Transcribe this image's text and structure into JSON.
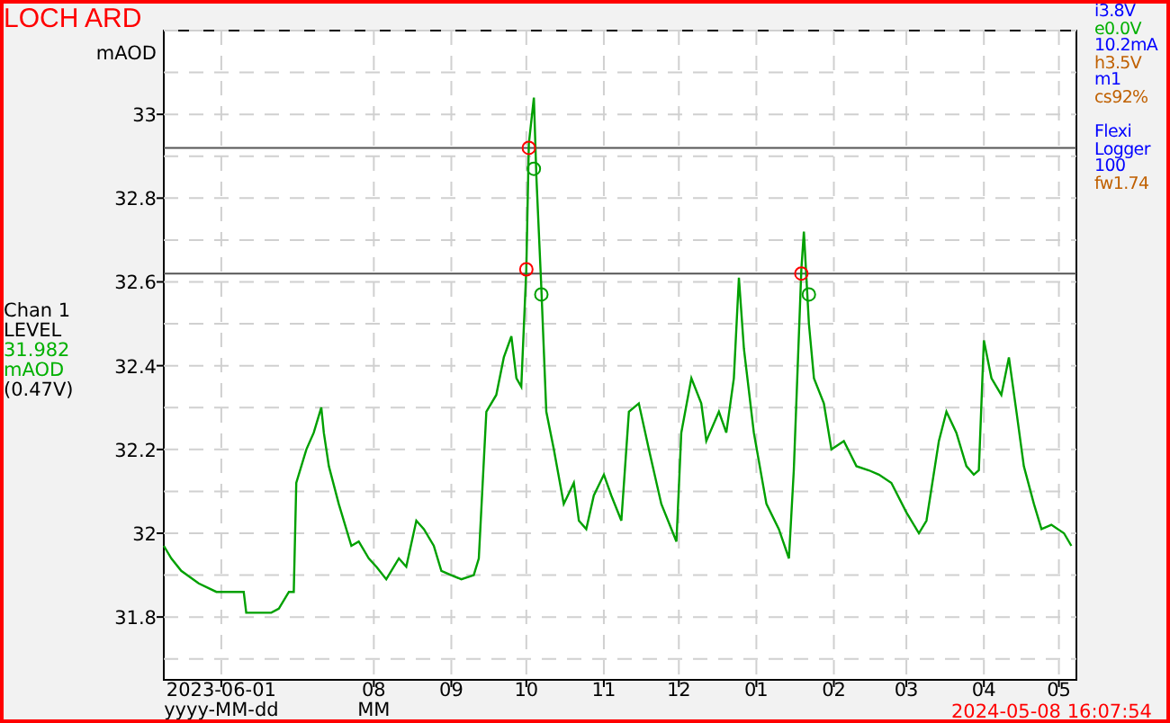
{
  "title": "LOCH ARD",
  "channel": {
    "type": "LEVEL",
    "reading": "31.982",
    "unit": "mAOD",
    "voltage": "(0.47V)"
  },
  "status": [
    {
      "text": "i3.8V",
      "color": "#0000ff"
    },
    {
      "text": "e0.0V",
      "color": "#00b000"
    },
    {
      "text": "10.2mA",
      "color": "#0000ff"
    },
    {
      "text": "h3.5V",
      "color": "#c06000"
    },
    {
      "text": "m1",
      "color": "#0000ff"
    },
    {
      "text": "cs92%",
      "color": "#c06000"
    }
  ],
  "logger": [
    {
      "text": "Flexi",
      "color": "#0000ff"
    },
    {
      "text": "Logger",
      "color": "#0000ff"
    },
    {
      "text": "100",
      "color": "#0000ff"
    },
    {
      "text": "fw1.74",
      "color": "#c06000"
    }
  ],
  "chart": {
    "format_labels": [
      "yyyy-MM-dd",
      "MM"
    ],
    "chart_data": {
      "type": "line",
      "ylabel": "mAOD",
      "x": [
        "2023-05-09",
        "2023-05-12",
        "2023-05-16",
        "2023-05-23",
        "2023-05-30",
        "2023-06-10",
        "2023-06-11",
        "2023-06-21",
        "2023-06-24",
        "2023-06-28",
        "2023-06-30",
        "2023-07-01",
        "2023-07-05",
        "2023-07-08",
        "2023-07-11",
        "2023-07-12",
        "2023-07-14",
        "2023-07-18",
        "2023-07-23",
        "2023-07-26",
        "2023-07-30",
        "2023-08-02",
        "2023-08-06",
        "2023-08-11",
        "2023-08-14",
        "2023-08-18",
        "2023-08-21",
        "2023-08-25",
        "2023-08-28",
        "2023-09-01",
        "2023-09-05",
        "2023-09-10",
        "2023-09-12",
        "2023-09-15",
        "2023-09-19",
        "2023-09-22",
        "2023-09-25",
        "2023-09-27",
        "2023-09-29",
        "2023-10-01",
        "2023-10-02",
        "2023-10-04",
        "2023-10-05",
        "2023-10-07",
        "2023-10-09",
        "2023-10-12",
        "2023-10-16",
        "2023-10-20",
        "2023-10-22",
        "2023-10-25",
        "2023-10-28",
        "2023-11-01",
        "2023-11-04",
        "2023-11-08",
        "2023-11-11",
        "2023-11-15",
        "2023-11-19",
        "2023-11-24",
        "2023-11-30",
        "2023-12-02",
        "2023-12-06",
        "2023-12-10",
        "2023-12-12",
        "2023-12-17",
        "2023-12-20",
        "2023-12-23",
        "2023-12-25",
        "2023-12-27",
        "2023-12-31",
        "2024-01-05",
        "2024-01-10",
        "2024-01-14",
        "2024-01-16",
        "2024-01-19",
        "2024-01-20",
        "2024-01-22",
        "2024-01-24",
        "2024-01-28",
        "2024-01-31",
        "2024-02-05",
        "2024-02-10",
        "2024-02-15",
        "2024-02-19",
        "2024-02-24",
        "2024-03-01",
        "2024-03-06",
        "2024-03-09",
        "2024-03-14",
        "2024-03-17",
        "2024-03-21",
        "2024-03-25",
        "2024-03-28",
        "2024-03-30",
        "2024-04-01",
        "2024-04-04",
        "2024-04-08",
        "2024-04-11",
        "2024-04-14",
        "2024-04-17",
        "2024-04-21",
        "2024-04-24",
        "2024-04-28",
        "2024-05-03",
        "2024-05-06"
      ],
      "series": [
        {
          "name": "Chan 1",
          "color": "#00a000",
          "values": [
            31.97,
            31.94,
            31.91,
            31.88,
            31.86,
            31.86,
            31.81,
            31.81,
            31.82,
            31.86,
            31.86,
            32.12,
            32.2,
            32.24,
            32.3,
            32.24,
            32.16,
            32.07,
            31.97,
            31.98,
            31.94,
            31.92,
            31.89,
            31.94,
            31.92,
            32.03,
            32.01,
            31.97,
            31.91,
            31.9,
            31.89,
            31.9,
            31.94,
            32.29,
            32.33,
            32.42,
            32.47,
            32.37,
            32.35,
            32.63,
            32.93,
            33.04,
            32.85,
            32.59,
            32.29,
            32.2,
            32.07,
            32.12,
            32.03,
            32.01,
            32.09,
            32.14,
            32.09,
            32.03,
            32.29,
            32.31,
            32.2,
            32.07,
            31.98,
            32.24,
            32.37,
            32.31,
            32.22,
            32.29,
            32.24,
            32.37,
            32.61,
            32.44,
            32.24,
            32.07,
            32.01,
            31.94,
            32.15,
            32.63,
            32.72,
            32.5,
            32.37,
            32.31,
            32.2,
            32.22,
            32.16,
            32.15,
            32.14,
            32.12,
            32.05,
            32.0,
            32.03,
            32.22,
            32.29,
            32.24,
            32.16,
            32.14,
            32.15,
            32.46,
            32.37,
            32.33,
            32.42,
            32.29,
            32.16,
            32.07,
            32.01,
            32.02,
            32.0,
            31.97
          ]
        },
        {
          "type": "scatter",
          "color": "#ff0000",
          "values": [
            null,
            null,
            null,
            null,
            null,
            null,
            null,
            null,
            null,
            null,
            null,
            null,
            null,
            null,
            null,
            null,
            null,
            null,
            null,
            null,
            null,
            null,
            null,
            null,
            null,
            null,
            null,
            null,
            null,
            null,
            null,
            null,
            null,
            null,
            null,
            null,
            null,
            null,
            null,
            32.63,
            32.92,
            null,
            null,
            null,
            null,
            null,
            null,
            null,
            null,
            null,
            null,
            null,
            null,
            null,
            null,
            null,
            null,
            null,
            null,
            null,
            null,
            null,
            null,
            null,
            null,
            null,
            null,
            null,
            null,
            null,
            null,
            null,
            null,
            32.62,
            null,
            null,
            null,
            null,
            null,
            null,
            null,
            null,
            null,
            null,
            null,
            null,
            null,
            null,
            null,
            null,
            null,
            null,
            null,
            null,
            null,
            null,
            null,
            null,
            null,
            null,
            null,
            null,
            null,
            null
          ]
        },
        {
          "type": "scatter",
          "color": "#00a000",
          "values": [
            null,
            null,
            null,
            null,
            null,
            null,
            null,
            null,
            null,
            null,
            null,
            null,
            null,
            null,
            null,
            null,
            null,
            null,
            null,
            null,
            null,
            null,
            null,
            null,
            null,
            null,
            null,
            null,
            null,
            null,
            null,
            null,
            null,
            null,
            null,
            null,
            null,
            null,
            null,
            null,
            null,
            32.87,
            null,
            32.57,
            null,
            null,
            null,
            null,
            null,
            null,
            null,
            null,
            null,
            null,
            null,
            null,
            null,
            null,
            null,
            null,
            null,
            null,
            null,
            null,
            null,
            null,
            null,
            null,
            null,
            null,
            null,
            null,
            null,
            null,
            null,
            32.57,
            null,
            null,
            null,
            null,
            null,
            null,
            null,
            null,
            null,
            null,
            null,
            null,
            null,
            null,
            null,
            null,
            null,
            null,
            null,
            null,
            null,
            null,
            null,
            null,
            null,
            null,
            null,
            null
          ]
        }
      ],
      "grid": true,
      "xlim": [
        "2023-05-09",
        "2024-05-08"
      ],
      "ylim": [
        31.65,
        33.2
      ],
      "xticks": [
        {
          "value": "2023-06-01",
          "label": "2023-06-01"
        },
        {
          "value": "2023-08-01",
          "label": "08"
        },
        {
          "value": "2023-09-01",
          "label": "09"
        },
        {
          "value": "2023-10-01",
          "label": "10"
        },
        {
          "value": "2023-11-01",
          "label": "11"
        },
        {
          "value": "2023-12-01",
          "label": "12"
        },
        {
          "value": "2024-01-01",
          "label": "01"
        },
        {
          "value": "2024-02-01",
          "label": "02"
        },
        {
          "value": "2024-03-01",
          "label": "03"
        },
        {
          "value": "2024-04-01",
          "label": "04"
        },
        {
          "value": "2024-05-01",
          "label": "05"
        }
      ],
      "yticks": [
        31.8,
        32,
        32.2,
        32.4,
        32.6,
        32.8,
        33
      ],
      "ref_lines": [
        {
          "axis": "y",
          "value": 32.92
        },
        {
          "axis": "y",
          "value": 32.62
        }
      ]
    }
  },
  "timestamp": "2024-05-08 16:07:54"
}
